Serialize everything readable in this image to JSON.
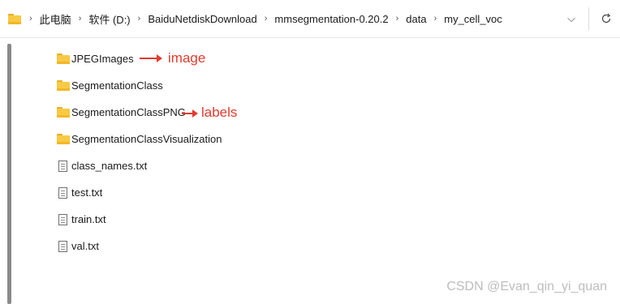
{
  "address_bar": {
    "crumbs": [
      "此电脑",
      "软件 (D:)",
      "BaiduNetdiskDownload",
      "mmsegmentation-0.20.2",
      "data",
      "my_cell_voc"
    ],
    "separator": "›",
    "dropdown_glyph": "⌵",
    "refresh_glyph": "↻"
  },
  "files": [
    {
      "name": "JPEGImages",
      "type": "folder"
    },
    {
      "name": "SegmentationClass",
      "type": "folder"
    },
    {
      "name": "SegmentationClassPNG",
      "type": "folder"
    },
    {
      "name": "SegmentationClassVisualization",
      "type": "folder"
    },
    {
      "name": "class_names.txt",
      "type": "file"
    },
    {
      "name": "test.txt",
      "type": "file"
    },
    {
      "name": "train.txt",
      "type": "file"
    },
    {
      "name": "val.txt",
      "type": "file"
    }
  ],
  "annotations": {
    "image_label": "image",
    "labels_label": "labels",
    "color": "#e23b2e"
  },
  "watermark": "CSDN @Evan_qin_yi_quan",
  "icons": {
    "folder": "folder-icon",
    "file": "text-file-icon",
    "refresh": "refresh-icon",
    "dropdown": "chevron-down-icon"
  }
}
